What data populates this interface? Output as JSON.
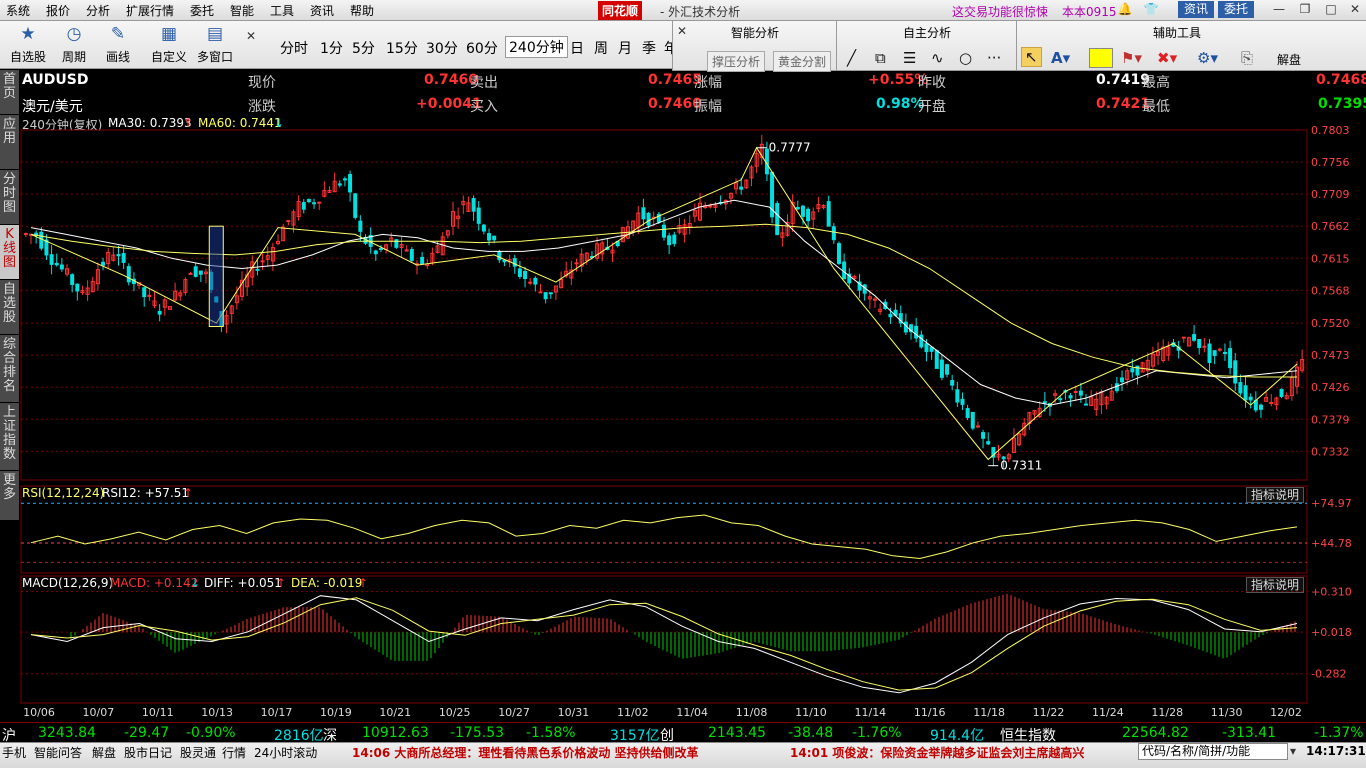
{
  "menu": [
    "系统",
    "报价",
    "分析",
    "扩展行情",
    "委托",
    "智能",
    "工具",
    "资讯",
    "帮助"
  ],
  "brand": "同花顺",
  "app_title": "- 外汇技术分析",
  "promo": "这交易功能很惊悚",
  "version": "本本0915",
  "top_buttons": {
    "news": "资讯",
    "trade": "委托"
  },
  "toolbar": {
    "items": [
      {
        "label": "自选股",
        "icon": "star-icon"
      },
      {
        "label": "周期",
        "icon": "clock-icon"
      },
      {
        "label": "画线",
        "icon": "pencil-icon"
      },
      {
        "label": "自定义",
        "icon": "custom-icon"
      },
      {
        "label": "多窗口",
        "icon": "grid-icon"
      }
    ],
    "periods": [
      "分时",
      "1分",
      "5分",
      "15分",
      "30分",
      "60分",
      "240分钟",
      "日",
      "周",
      "月",
      "季",
      "年"
    ],
    "active_period": "240分钟"
  },
  "panels": {
    "smart": {
      "title": "智能分析",
      "btn1": "撑压分析",
      "btn2": "黄金分割"
    },
    "self": {
      "title": "自主分析"
    },
    "aux": {
      "title": "辅助工具",
      "unlock": "解盘"
    }
  },
  "side_tabs": [
    "首页",
    "应用",
    "分时图",
    "K线图",
    "自选股",
    "综合排名",
    "上证指数",
    "更多"
  ],
  "quote": {
    "code": "AUDUSD",
    "name": "澳元/美元",
    "row1": [
      {
        "label": "现价",
        "value": "0.7460"
      },
      {
        "label": "卖出",
        "value": "0.7465"
      },
      {
        "label": "涨幅",
        "value": "+0.55%"
      },
      {
        "label": "昨收",
        "value": "0.7419"
      },
      {
        "label": "最高",
        "value": "0.7468"
      }
    ],
    "row2": [
      {
        "label": "涨跌",
        "value": "+0.0041"
      },
      {
        "label": "买入",
        "value": "0.7460"
      },
      {
        "label": "振幅",
        "value": "0.98%"
      },
      {
        "label": "开盘",
        "value": "0.7421"
      },
      {
        "label": "最低",
        "value": "0.7395"
      }
    ]
  },
  "indicators": {
    "main": {
      "period": "240分钟(复权)",
      "ma30": "MA30: 0.7393",
      "ma60": "MA60: 0.7441"
    },
    "rsi": {
      "label": "RSI(12,12,24)",
      "value": "RSI12: +57.51",
      "levels": [
        "+74.97",
        "+44.78"
      ]
    },
    "macd": {
      "label": "MACD(12,26,9)",
      "macd": "MACD: +0.142",
      "diff": "DIFF: +0.051",
      "dea": "DEA: -0.019",
      "levels": [
        "+0.310",
        "+0.018",
        "-0.282"
      ]
    },
    "explain": "指标说明"
  },
  "chart_data": {
    "type": "candlestick",
    "symbol": "AUDUSD",
    "price_axis": {
      "ticks": [
        0.7803,
        0.7756,
        0.7709,
        0.7662,
        0.7615,
        0.7568,
        0.752,
        0.7473,
        0.7426,
        0.7379,
        0.7332
      ],
      "ylim": [
        0.729,
        0.7803
      ]
    },
    "date_ticks": [
      "10/06",
      "10/07",
      "10/11",
      "10/13",
      "10/17",
      "10/19",
      "10/21",
      "10/25",
      "10/27",
      "10/31",
      "11/02",
      "11/04",
      "11/08",
      "11/10",
      "11/14",
      "11/16",
      "11/18",
      "11/22",
      "11/24",
      "11/28",
      "11/30",
      "12/02"
    ],
    "annotations": [
      {
        "label": "0.7777",
        "value": 0.7777
      },
      {
        "label": "0.7311",
        "value": 0.7311
      }
    ],
    "price_path": [
      0.765,
      0.7615,
      0.759,
      0.756,
      0.76,
      0.7625,
      0.759,
      0.756,
      0.754,
      0.756,
      0.76,
      0.759,
      0.752,
      0.756,
      0.76,
      0.762,
      0.766,
      0.769,
      0.77,
      0.772,
      0.773,
      0.765,
      0.762,
      0.764,
      0.762,
      0.7605,
      0.763,
      0.768,
      0.77,
      0.766,
      0.762,
      0.76,
      0.758,
      0.756,
      0.758,
      0.761,
      0.7625,
      0.763,
      0.765,
      0.768,
      0.767,
      0.764,
      0.766,
      0.769,
      0.77,
      0.771,
      0.773,
      0.7777,
      0.764,
      0.769,
      0.768,
      0.77,
      0.76,
      0.758,
      0.755,
      0.754,
      0.752,
      0.75,
      0.747,
      0.744,
      0.74,
      0.736,
      0.732,
      0.733,
      0.737,
      0.74,
      0.741,
      0.742,
      0.74,
      0.741,
      0.743,
      0.745,
      0.746,
      0.748,
      0.749,
      0.75,
      0.747,
      0.748,
      0.742,
      0.74,
      0.741,
      0.742,
      0.746
    ],
    "ma30_path": [
      0.766,
      0.765,
      0.764,
      0.763,
      0.7615,
      0.7605,
      0.76,
      0.7605,
      0.762,
      0.764,
      0.765,
      0.7645,
      0.763,
      0.7625,
      0.7625,
      0.763,
      0.764,
      0.765,
      0.767,
      0.769,
      0.77,
      0.769,
      0.764,
      0.76,
      0.756,
      0.751,
      0.747,
      0.743,
      0.741,
      0.74,
      0.741,
      0.743,
      0.745,
      0.7445,
      0.744,
      0.7445,
      0.745
    ],
    "ma60_path": [
      0.765,
      0.764,
      0.7632,
      0.7625,
      0.7622,
      0.762,
      0.7625,
      0.7635,
      0.764,
      0.764,
      0.764,
      0.7638,
      0.764,
      0.7645,
      0.765,
      0.7655,
      0.766,
      0.7662,
      0.7665,
      0.766,
      0.765,
      0.763,
      0.76,
      0.756,
      0.752,
      0.749,
      0.747,
      0.7455,
      0.7448,
      0.7443,
      0.7441,
      0.7441
    ],
    "rsi_path": [
      45,
      50,
      44,
      48,
      53,
      47,
      55,
      58,
      52,
      60,
      63,
      62,
      56,
      48,
      52,
      58,
      62,
      60,
      50,
      52,
      58,
      56,
      62,
      60,
      64,
      66,
      60,
      58,
      50,
      44,
      42,
      40,
      35,
      33,
      38,
      45,
      50,
      52,
      55,
      58,
      60,
      62,
      60,
      55,
      46,
      50,
      54,
      57
    ],
    "macd_path": [
      0,
      -0.05,
      0.05,
      0.08,
      -0.03,
      -0.05,
      0.02,
      0.15,
      0.28,
      0.25,
      0.1,
      -0.05,
      0.04,
      0.12,
      0.1,
      0.18,
      0.25,
      0.2,
      0.06,
      -0.05,
      -0.1,
      -0.2,
      -0.3,
      -0.38,
      -0.42,
      -0.35,
      -0.2,
      0.0,
      0.12,
      0.22,
      0.26,
      0.25,
      0.18,
      0.04,
      0.02,
      0.08
    ],
    "series": []
  },
  "ticker": {
    "sh": {
      "label": "沪",
      "value": "3243.84",
      "chg": "-29.47",
      "pct": "-0.90%",
      "amt": "2816亿"
    },
    "sz": {
      "label": "深",
      "value": "10912.63",
      "chg": "-175.53",
      "pct": "-1.58%",
      "amt": "3157亿"
    },
    "cy": {
      "label": "创",
      "value": "2143.45",
      "chg": "-38.48",
      "pct": "-1.76%",
      "amt": "914.4亿"
    },
    "hs": {
      "label": "恒生指数",
      "value": "22564.82",
      "chg": "-313.41",
      "pct": "-1.37%"
    }
  },
  "status": {
    "items": [
      "手机",
      "智能问答",
      "解盘",
      "股市日记",
      "股灵通",
      "行情",
      "24小时滚动"
    ],
    "news1": "14:06 大商所总经理：理性看待黑色系价格波动 坚持供给侧改革",
    "news2": "14:01 项俊波：保险资金举牌越多证监会刘主席越高兴",
    "search_placeholder": "代码/名称/简拼/功能",
    "clock": "14:17:31"
  },
  "colors": {
    "up": "#ff3333",
    "down": "#00e0e0",
    "ma": "#ffff66",
    "grid": "#7a0000"
  }
}
